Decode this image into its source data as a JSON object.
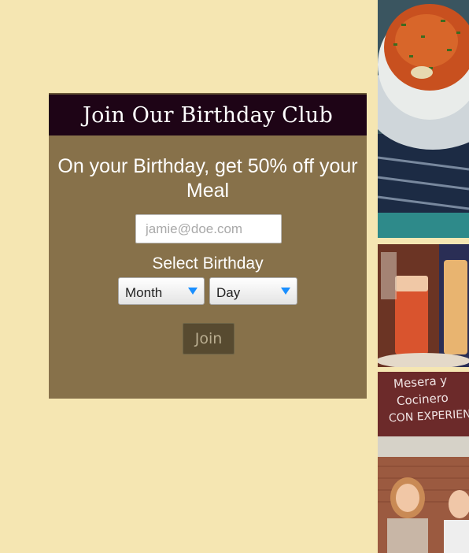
{
  "birthday_club": {
    "title": "Join Our Birthday Club",
    "offer_text": "On your Birthday, get 50% off your Meal",
    "email_placeholder": "jamie@doe.com",
    "select_birthday_label": "Select Birthday",
    "month_select": "Month",
    "day_select": "Day",
    "join_button": "Join"
  },
  "photos": {
    "chalkboard_text": [
      "Mesera y",
      "Cocinero",
      "CON EXPERIENCIA"
    ]
  },
  "colors": {
    "page_background": "#f5e6b2",
    "card_background": "#87714a",
    "header_background": "#1e0416",
    "join_button": "#574a30",
    "select_arrow": "#1a8fff"
  }
}
